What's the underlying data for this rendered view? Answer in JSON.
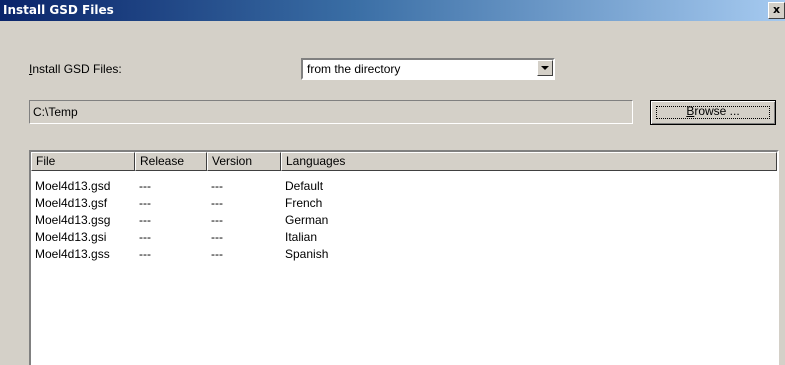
{
  "window": {
    "title": "Install GSD Files",
    "close_glyph": "x"
  },
  "install_label": {
    "prefix": "",
    "accel": "I",
    "rest": "nstall GSD Files:"
  },
  "source_select": {
    "value": "from the directory"
  },
  "path": {
    "value": "C:\\Temp"
  },
  "browse": {
    "accel": "B",
    "rest": "rowse ..."
  },
  "table": {
    "columns": [
      "File",
      "Release",
      "Version",
      "Languages"
    ],
    "rows": [
      [
        "Moel4d13.gsd",
        "---",
        "---",
        "Default"
      ],
      [
        "Moel4d13.gsf",
        "---",
        "---",
        "French"
      ],
      [
        "Moel4d13.gsg",
        "---",
        "---",
        "German"
      ],
      [
        "Moel4d13.gsi",
        "---",
        "---",
        "Italian"
      ],
      [
        "Moel4d13.gss",
        "---",
        "---",
        "Spanish"
      ]
    ]
  }
}
